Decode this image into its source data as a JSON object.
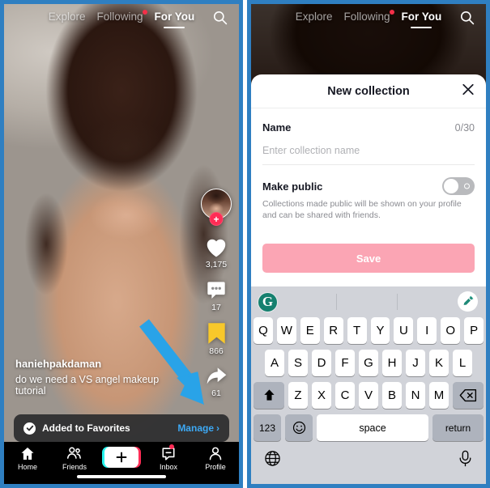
{
  "app": {
    "name": "TikTok",
    "accent_red": "#fe2c55",
    "accent_blue": "#3da9f5",
    "bookmark_yellow": "#f8c82a",
    "border_blue": "#2f7fc1"
  },
  "topnav": {
    "items": [
      {
        "label": "Explore",
        "active": false,
        "dot": false
      },
      {
        "label": "Following",
        "active": false,
        "dot": true
      },
      {
        "label": "For You",
        "active": true,
        "dot": false
      }
    ],
    "search_icon": "search-icon"
  },
  "video": {
    "handle": "haniehpakdaman",
    "caption": "do we need a VS angel makeup tutorial",
    "actions": [
      {
        "name": "avatar",
        "icon": "avatar",
        "badge": "+"
      },
      {
        "name": "like",
        "icon": "heart-icon",
        "count": "3,175"
      },
      {
        "name": "comment",
        "icon": "comment-icon",
        "count": "17"
      },
      {
        "name": "favorite",
        "icon": "bookmark-icon",
        "count": "866"
      },
      {
        "name": "share",
        "icon": "share-arrow-icon",
        "count": "61"
      }
    ]
  },
  "toast": {
    "icon": "check-circle-icon",
    "text": "Added to Favorites",
    "action_label": "Manage",
    "action_chevron": "›"
  },
  "bottomnav": {
    "items": [
      {
        "label": "Home",
        "icon": "home-icon",
        "dot": false
      },
      {
        "label": "Friends",
        "icon": "friends-icon",
        "dot": false
      },
      {
        "label": "",
        "icon": "create-plus-icon",
        "dot": false
      },
      {
        "label": "Inbox",
        "icon": "inbox-icon",
        "dot": true
      },
      {
        "label": "Profile",
        "icon": "profile-icon",
        "dot": false
      }
    ]
  },
  "modal": {
    "title": "New collection",
    "close_icon": "close-icon",
    "name_label": "Name",
    "char_count": "0/30",
    "name_value": "",
    "name_placeholder": "Enter collection name",
    "make_public_label": "Make public",
    "make_public_on": false,
    "make_public_desc": "Collections made public will be shown on your profile and can be shared with friends.",
    "save_label": "Save",
    "save_enabled": false
  },
  "keyboard": {
    "suggestion_bar": {
      "brand_icon": "grammarly-g-icon",
      "brand_letter": "G",
      "assistant_icon": "magic-pencil-icon"
    },
    "row1": [
      "Q",
      "W",
      "E",
      "R",
      "T",
      "Y",
      "U",
      "I",
      "O",
      "P"
    ],
    "row2": [
      "A",
      "S",
      "D",
      "F",
      "G",
      "H",
      "J",
      "K",
      "L"
    ],
    "row3": [
      "Z",
      "X",
      "C",
      "V",
      "B",
      "N",
      "M"
    ],
    "shift_icon": "shift-icon",
    "backspace_icon": "backspace-icon",
    "numeric_label": "123",
    "emoji_icon": "emoji-icon",
    "space_label": "space",
    "return_label": "return",
    "globe_icon": "globe-icon",
    "mic_icon": "mic-icon"
  },
  "annotation": {
    "arrow_color": "#29a3e8",
    "arrow_icon": "pointer-arrow-icon"
  }
}
